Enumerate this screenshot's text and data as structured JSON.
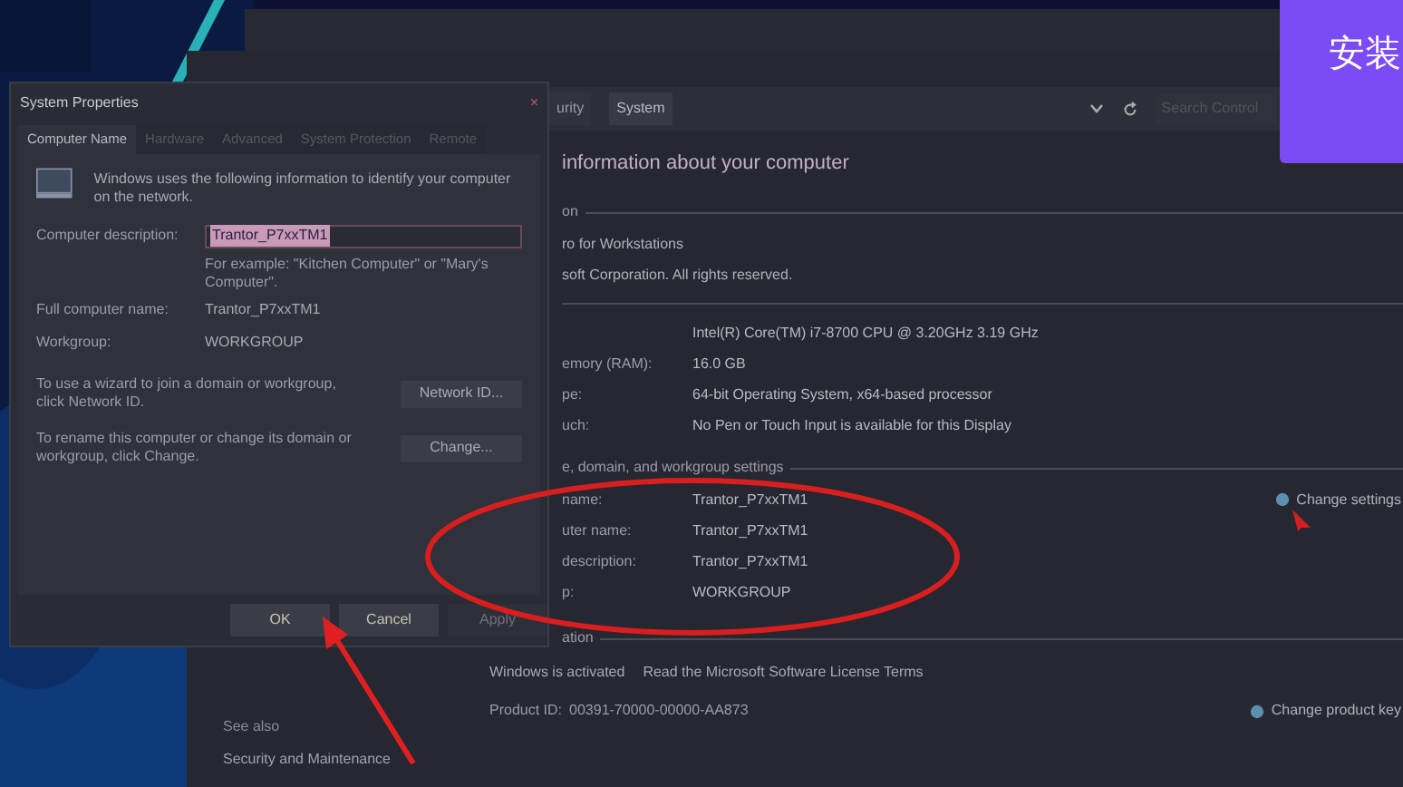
{
  "banner": {
    "text": "安装"
  },
  "control_panel": {
    "breadcrumbs": [
      {
        "label": "urity",
        "selected": false
      },
      {
        "label": "System",
        "selected": true
      }
    ],
    "search": {
      "placeholder": "Search Control"
    },
    "heading": "information about your computer",
    "edition": {
      "title": "on",
      "lines": [
        "ro for Workstations",
        "soft Corporation. All rights reserved."
      ]
    },
    "system_rows": [
      {
        "value": "Intel(R) Core(TM) i7-8700 CPU @ 3.20GHz   3.19 GHz"
      },
      {
        "label": "emory (RAM):",
        "value": "16.0 GB"
      },
      {
        "label": "pe:",
        "value": "64-bit Operating System, x64-based processor"
      },
      {
        "label": "uch:",
        "value": "No Pen or Touch Input is available for this Display"
      }
    ],
    "name_settings": {
      "title": "e, domain, and workgroup settings",
      "link": "Change settings",
      "rows": [
        {
          "label": "name:",
          "value": "Trantor_P7xxTM1"
        },
        {
          "label": "uter name:",
          "value": "Trantor_P7xxTM1"
        },
        {
          "label": "description:",
          "value": "Trantor_P7xxTM1"
        },
        {
          "label": "p:",
          "value": "WORKGROUP"
        }
      ]
    },
    "activation": {
      "title": "ation",
      "status": "Windows is activated",
      "license_link": "Read the Microsoft Software License Terms",
      "product_id_label": "Product ID:",
      "product_id": "00391-70000-00000-AA873",
      "link": "Change product key"
    },
    "see_also": {
      "title": "See also",
      "items": [
        "Security and Maintenance"
      ]
    }
  },
  "dialog": {
    "title": "System Properties",
    "close": "×",
    "tabs": [
      {
        "label": "Computer Name",
        "selected": true
      },
      {
        "label": "Hardware",
        "selected": false
      },
      {
        "label": "Advanced",
        "selected": false
      },
      {
        "label": "System Protection",
        "selected": false
      },
      {
        "label": "Remote",
        "selected": false
      }
    ],
    "intro": "Windows uses the following information to identify your computer on the network.",
    "description": {
      "label": "Computer description:",
      "value": "Trantor_P7xxTM1",
      "selected": true
    },
    "example": "For example: \"Kitchen Computer\" or \"Mary's Computer\".",
    "info_rows": [
      {
        "label": "Full computer name:",
        "value": "Trantor_P7xxTM1"
      },
      {
        "label": "Workgroup:",
        "value": "WORKGROUP"
      }
    ],
    "actions": [
      {
        "text": "To use a wizard to join a domain or workgroup, click Network ID.",
        "button": "Network ID..."
      },
      {
        "text": "To rename this computer or change its domain or workgroup, click Change.",
        "button": "Change..."
      }
    ],
    "buttons": [
      {
        "label": "OK",
        "disabled": false
      },
      {
        "label": "Cancel",
        "disabled": false
      },
      {
        "label": "Apply",
        "disabled": true
      }
    ]
  }
}
